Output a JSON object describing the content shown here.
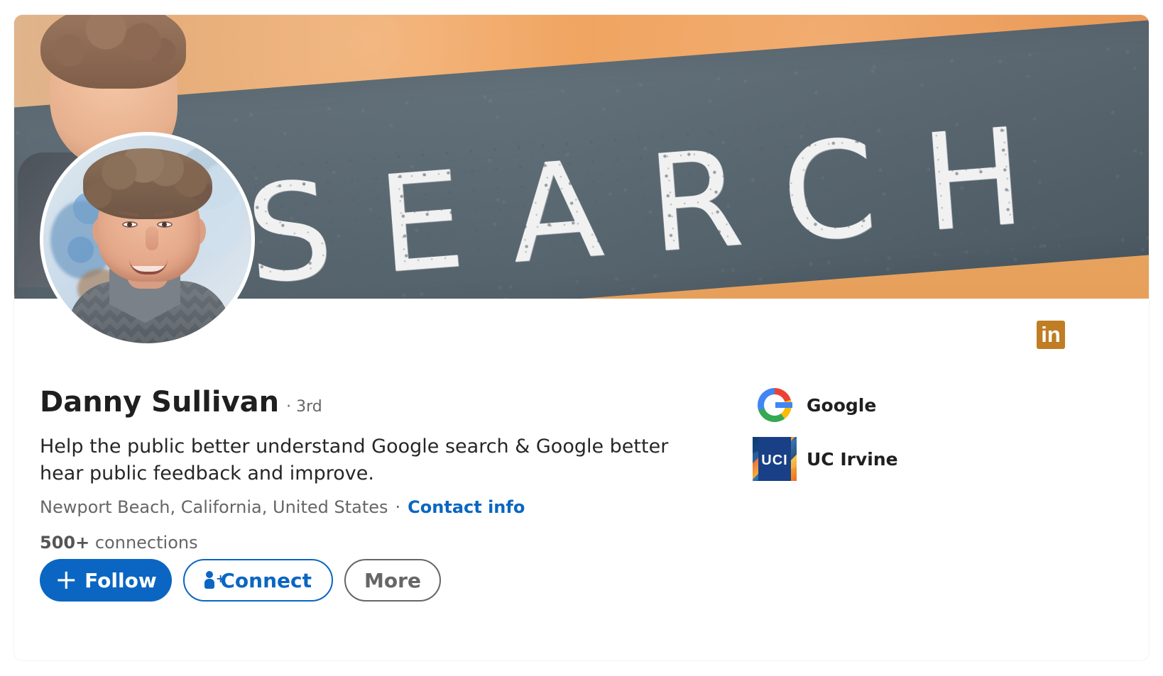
{
  "cover": {
    "text": "SEARCH"
  },
  "profile": {
    "name": "Danny Sullivan",
    "degree": "· 3rd",
    "headline": "Help the public better understand Google search & Google better hear public feedback and improve.",
    "location": "Newport Beach, California, United States",
    "separator": "·",
    "contact_info": "Contact info",
    "connections_count": "500+",
    "connections_label": "connections"
  },
  "actions": {
    "follow": "Follow",
    "connect": "Connect",
    "more": "More"
  },
  "companies": [
    {
      "name": "Google",
      "icon": "google-logo-icon"
    },
    {
      "name": "UC Irvine",
      "icon": "uci-logo-icon",
      "logo_text": "UCI"
    }
  ],
  "brand": {
    "linkedin_text": "in",
    "linkedin_color": "#C07D24",
    "primary_blue": "#0A66C2"
  }
}
